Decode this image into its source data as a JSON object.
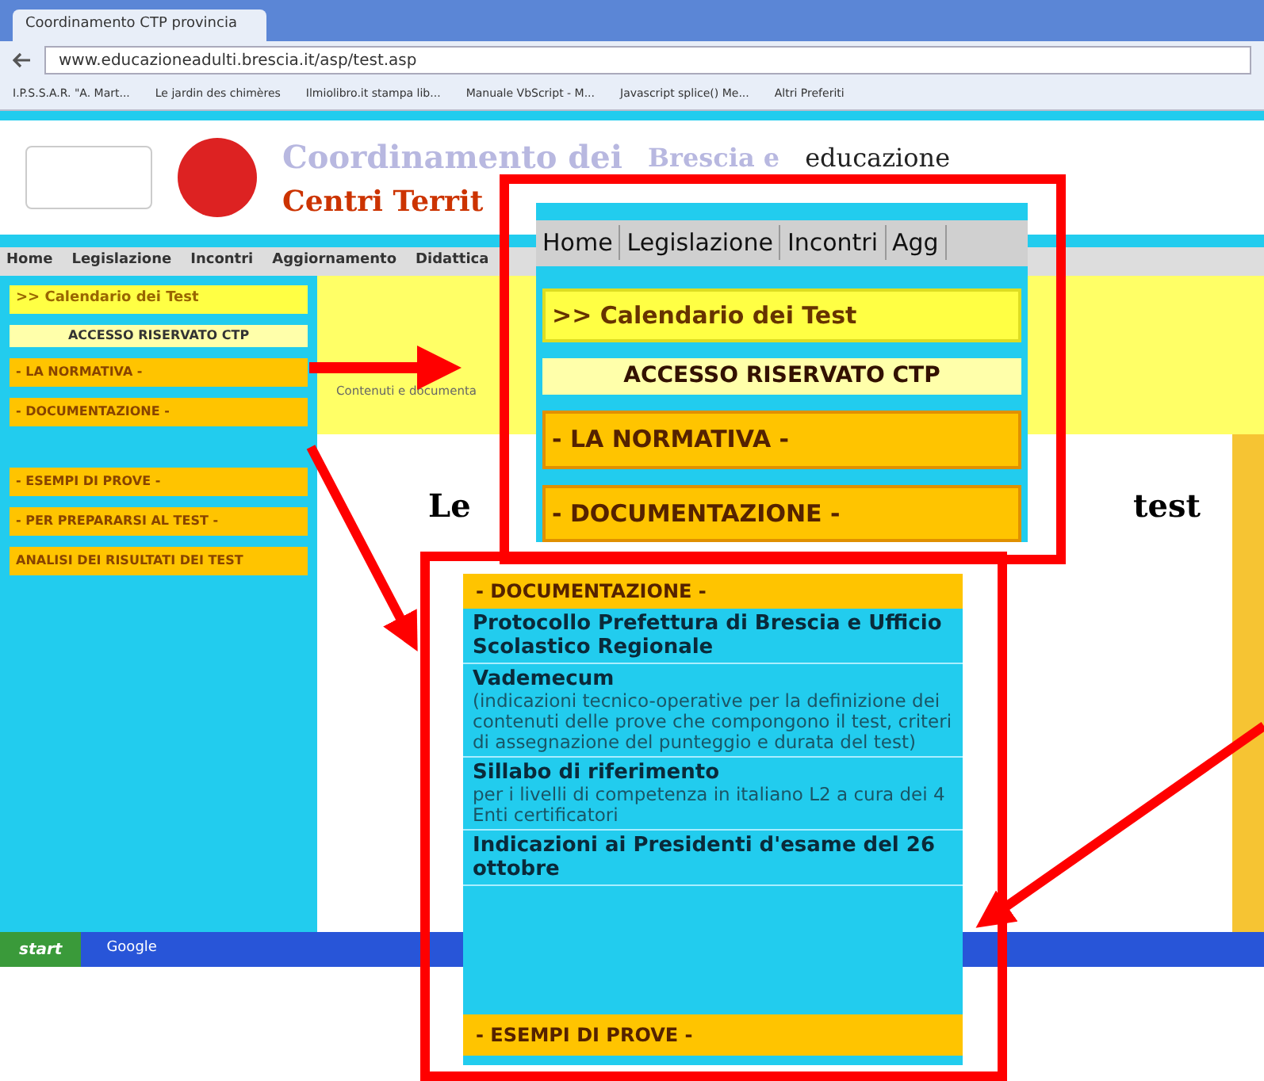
{
  "browser": {
    "tab_title": "Coordinamento CTP provincia",
    "url": "www.educazioneadulti.brescia.it/asp/test.asp",
    "bookmarks": [
      "I.P.S.S.A.R. \"A. Mart...",
      "Le jardin des chimères",
      "Ilmiolibro.it stampa lib...",
      "Manuale VbScript - M...",
      "Javascript splice() Me...",
      "Altri Preferiti"
    ]
  },
  "header": {
    "title_1": "Coordinamento dei",
    "title_2": "Centri Territ",
    "place": "Brescia e",
    "brand": "educazione"
  },
  "nav": [
    "Home",
    "Legislazione",
    "Incontri",
    "Aggiornamento",
    "Didattica"
  ],
  "sidebar": [
    {
      "label": ">> Calendario dei Test",
      "kind": "link"
    },
    {
      "label": "ACCESSO RISERVATO CTP",
      "kind": "heading"
    },
    {
      "label": "- LA NORMATIVA -",
      "kind": "menu"
    },
    {
      "label": "- DOCUMENTAZIONE -",
      "kind": "menu"
    },
    {
      "kind": "gap"
    },
    {
      "label": "- ESEMPI DI PROVE -",
      "kind": "menu"
    },
    {
      "label": "- PER PREPARARSI AL TEST -",
      "kind": "menu"
    },
    {
      "label": "ANALISI DEI RISULTATI DEI TEST",
      "kind": "menu"
    }
  ],
  "content": {
    "subtitle": "Contenuti e documenta",
    "heading_start": "Le",
    "heading_end": "test"
  },
  "taskbar": {
    "start": "start",
    "search": "Google"
  },
  "zoom_top": {
    "nav": [
      "Home",
      "Legislazione",
      "Incontri",
      "Agg"
    ],
    "items": [
      {
        "label": ">> Calendario dei Test",
        "kind": "link"
      },
      {
        "label": "ACCESSO RISERVATO CTP",
        "kind": "heading"
      },
      {
        "label": "- LA NORMATIVA -",
        "kind": "menu"
      },
      {
        "label": "- DOCUMENTAZIONE -",
        "kind": "menu"
      }
    ]
  },
  "zoom_bottom": {
    "header": "- DOCUMENTAZIONE -",
    "documents": [
      {
        "title": "Protocollo Prefettura di Brescia e Ufficio Scolastico Regionale"
      },
      {
        "title": "Vademecum",
        "description": "(indicazioni tecnico-operative per la definizione dei contenuti delle prove che compongono il test, criteri di assegnazione del punteggio e durata del test)"
      },
      {
        "title": "Sillabo di riferimento",
        "description": "per i livelli di competenza in italiano L2 a cura dei 4 Enti certificatori"
      },
      {
        "title": "Indicazioni ai Presidenti d'esame del 26 ottobre"
      }
    ],
    "footer": "- ESEMPI DI PROVE -"
  }
}
